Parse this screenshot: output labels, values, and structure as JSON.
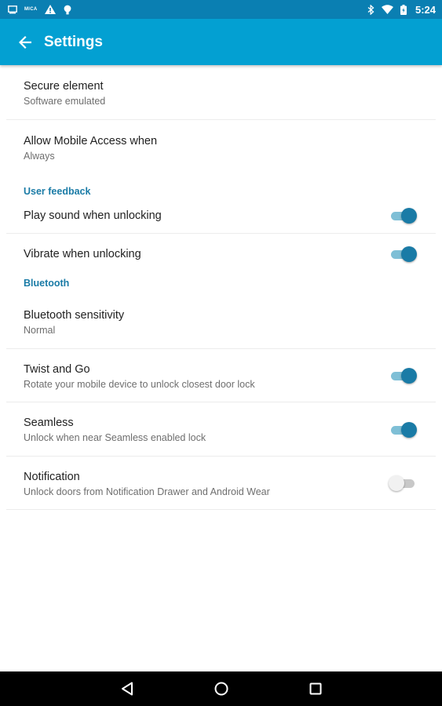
{
  "status_bar": {
    "left_tag": "MICA",
    "time": "5:24",
    "icons": [
      "screen-icon",
      "warning-icon",
      "android-icon",
      "bluetooth-icon",
      "wifi-icon",
      "battery-icon"
    ]
  },
  "app_bar": {
    "title": "Settings",
    "back_icon": "arrow-back-icon"
  },
  "settings": {
    "secure_element": {
      "title": "Secure element",
      "summary": "Software emulated"
    },
    "allow_mobile_access": {
      "title": "Allow Mobile Access when",
      "summary": "Always"
    },
    "user_feedback_header": "User feedback",
    "play_sound": {
      "title": "Play sound when unlocking",
      "enabled": true
    },
    "vibrate": {
      "title": "Vibrate when unlocking",
      "enabled": true
    },
    "bluetooth_header": "Bluetooth",
    "bluetooth_sensitivity": {
      "title": "Bluetooth sensitivity",
      "summary": "Normal"
    },
    "twist_and_go": {
      "title": "Twist and Go",
      "summary": "Rotate your mobile device to unlock closest door lock",
      "enabled": true
    },
    "seamless": {
      "title": "Seamless",
      "summary": "Unlock when near Seamless enabled lock",
      "enabled": true
    },
    "notification": {
      "title": "Notification",
      "summary": "Unlock doors from Notification Drawer and Android Wear",
      "enabled": false
    }
  },
  "nav_bar": {
    "icons": [
      "back-triangle-icon",
      "home-circle-icon",
      "recents-square-icon"
    ]
  },
  "colors": {
    "status_bar": "#0a7fb2",
    "app_bar": "#03a0d2",
    "accent": "#1a7ba6",
    "toggle_track_on": "#7fbfd6"
  }
}
